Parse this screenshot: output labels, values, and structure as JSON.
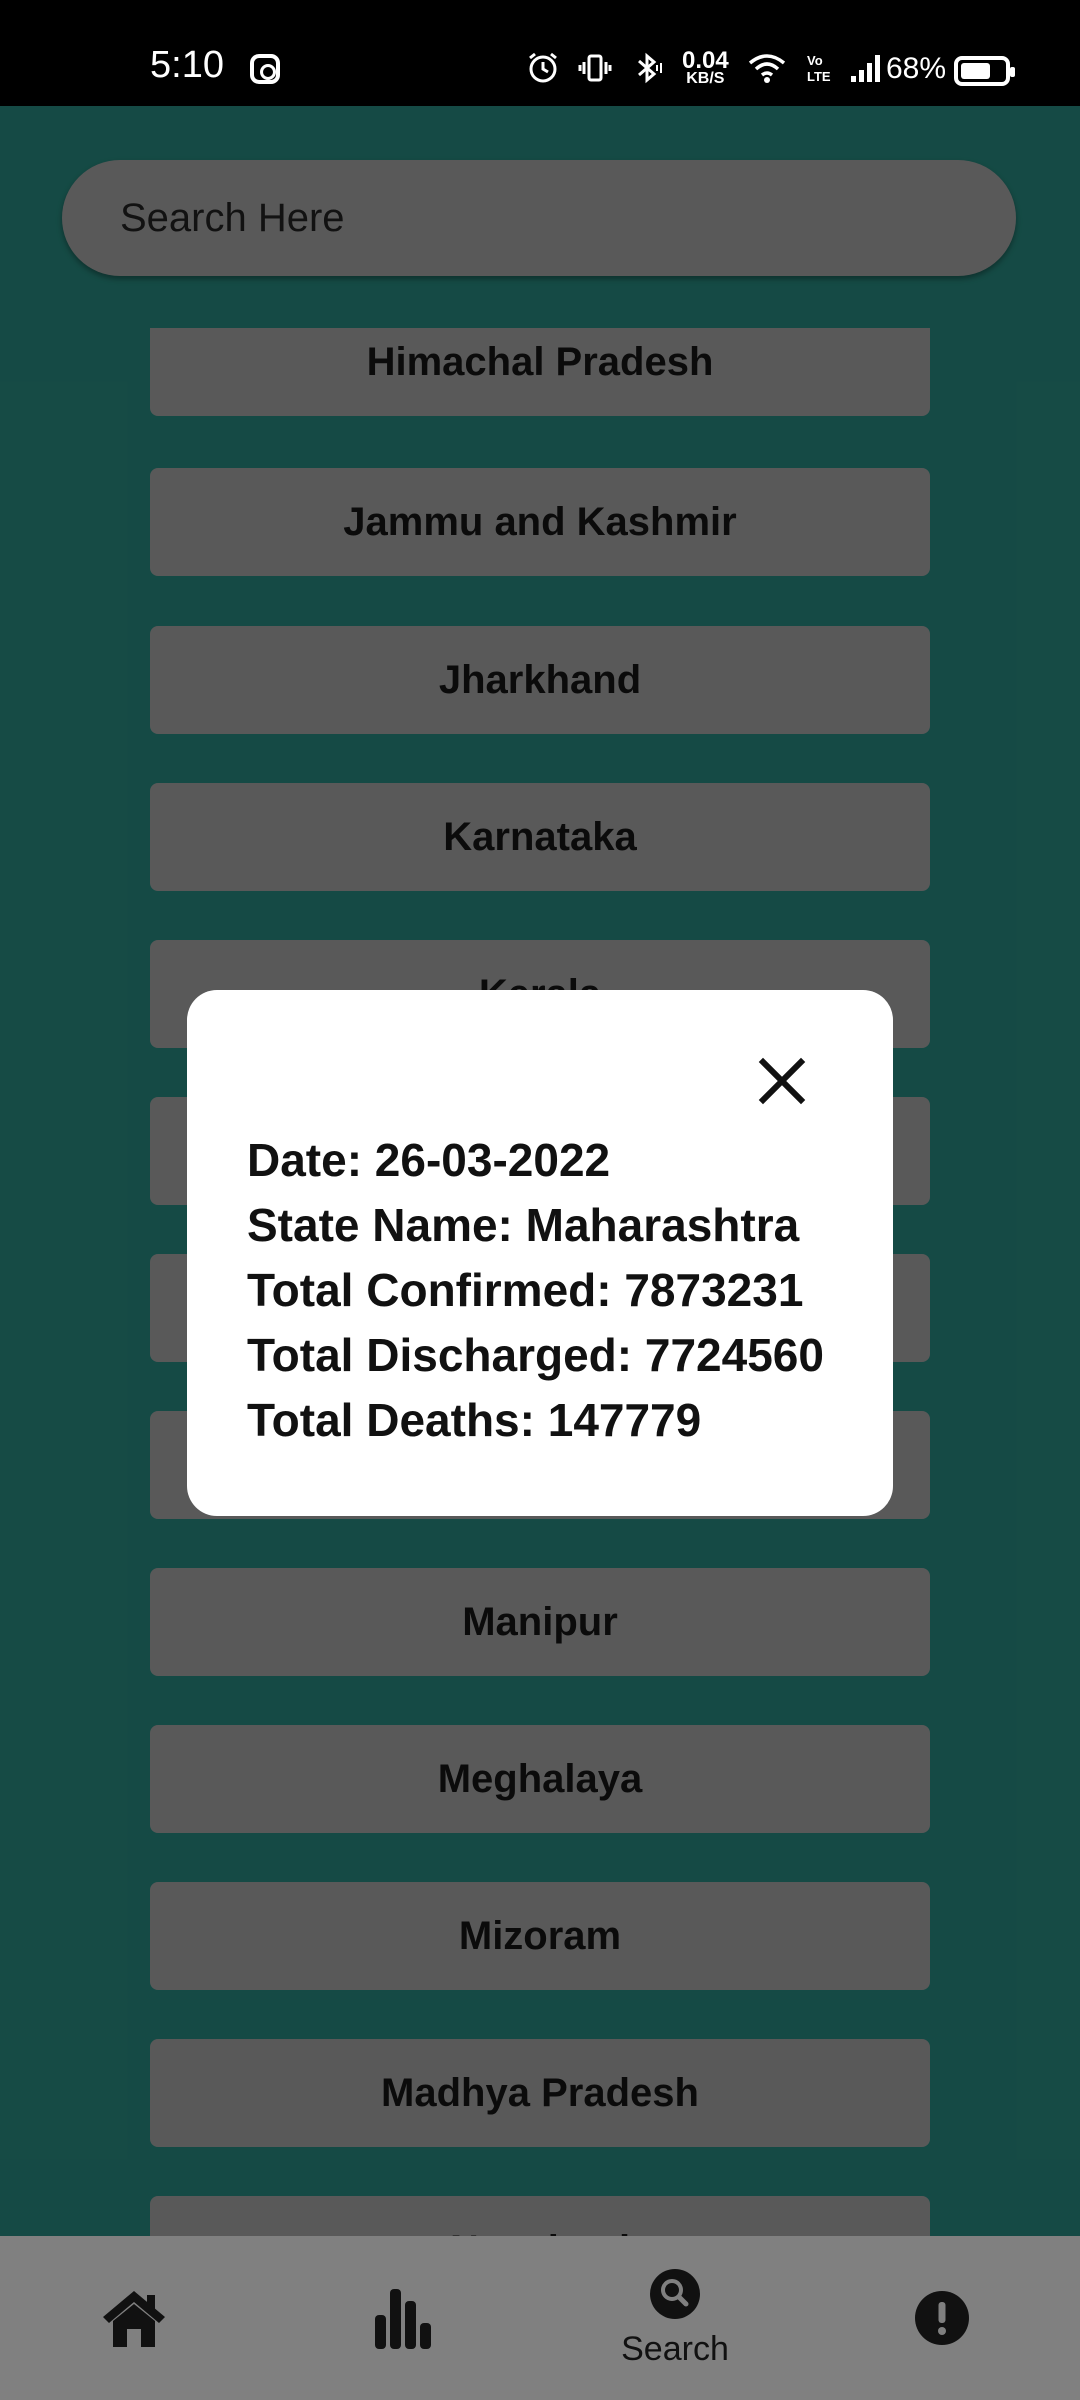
{
  "status_bar": {
    "time": "5:10",
    "network_rate": "0.04",
    "network_rate_unit": "KB/S",
    "battery_percent": "68%",
    "battery_level": 0.68,
    "icons": [
      "instagram-icon",
      "alarm-icon",
      "vibrate-icon",
      "bluetooth-icon",
      "wifi-icon",
      "volte-icon",
      "signal-icon",
      "battery-icon"
    ]
  },
  "search": {
    "placeholder": "Search Here",
    "value": ""
  },
  "state_list": [
    "Himachal Pradesh",
    "Jammu and Kashmir",
    "Jharkhand",
    "Karnataka",
    "Kerala",
    "",
    "",
    "",
    "Manipur",
    "Meghalaya",
    "Mizoram",
    "Madhya Pradesh",
    "Nagaland"
  ],
  "dialog": {
    "date": "Date: 26-03-2022",
    "state_name": "State Name: Maharashtra",
    "total_confirmed": "Total Confirmed: 7873231",
    "total_discharged": "Total Discharged: 7724560",
    "total_deaths": "Total Deaths: 147779",
    "close_icon": "close-icon"
  },
  "bottom_nav": [
    {
      "icon": "home-icon",
      "label": ""
    },
    {
      "icon": "bar-chart-icon",
      "label": ""
    },
    {
      "icon": "search-icon",
      "label": "Search"
    },
    {
      "icon": "info-icon",
      "label": ""
    }
  ],
  "colors": {
    "background": "#1f6b63",
    "card": "#808080",
    "dialog": "#ffffff",
    "nav_bar": "#808080",
    "status_bar": "#000000"
  }
}
